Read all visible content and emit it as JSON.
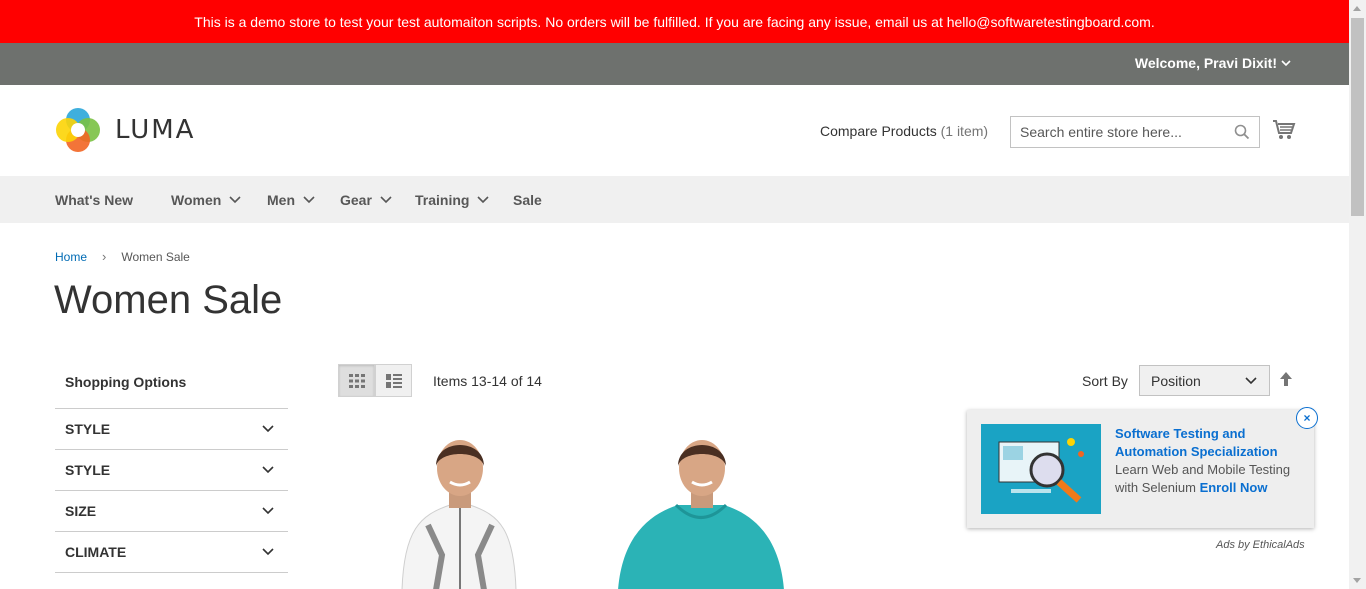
{
  "demo_notice": "This is a demo store to test your test automaiton scripts. No orders will be fulfilled. If you are facing any issue, email us at hello@softwaretestingboard.com.",
  "header": {
    "welcome": "Welcome, Pravi Dixit!",
    "logo_text": "LUMA",
    "compare_label": "Compare Products",
    "compare_count": "(1 item)",
    "search_placeholder": "Search entire store here..."
  },
  "nav": {
    "items": [
      {
        "label": "What's New",
        "has_dropdown": false
      },
      {
        "label": "Women",
        "has_dropdown": true
      },
      {
        "label": "Men",
        "has_dropdown": true
      },
      {
        "label": "Gear",
        "has_dropdown": true
      },
      {
        "label": "Training",
        "has_dropdown": true
      },
      {
        "label": "Sale",
        "has_dropdown": false
      }
    ]
  },
  "breadcrumb": {
    "home": "Home",
    "separator": "›",
    "current": "Women Sale"
  },
  "page_title": "Women Sale",
  "sidebar": {
    "title": "Shopping Options",
    "filters": [
      "STYLE",
      "STYLE",
      "SIZE",
      "CLIMATE"
    ]
  },
  "toolbar": {
    "items_count": "Items 13-14 of 14",
    "sort_label": "Sort By",
    "sort_value": "Position",
    "view_modes": [
      "grid",
      "list"
    ],
    "active_mode": "grid"
  },
  "ad": {
    "title": "Software Testing and Automation Specialization",
    "body": "Learn Web and Mobile Testing with Selenium",
    "cta": "Enroll Now",
    "by": "Ads by EthicalAds",
    "close": "×"
  },
  "colors": {
    "notice_bg": "#ff0000",
    "panel_bg": "#6e716e",
    "nav_bg": "#f0f0f0",
    "link": "#006bb4",
    "ad_accent": "#0a6fd0"
  }
}
